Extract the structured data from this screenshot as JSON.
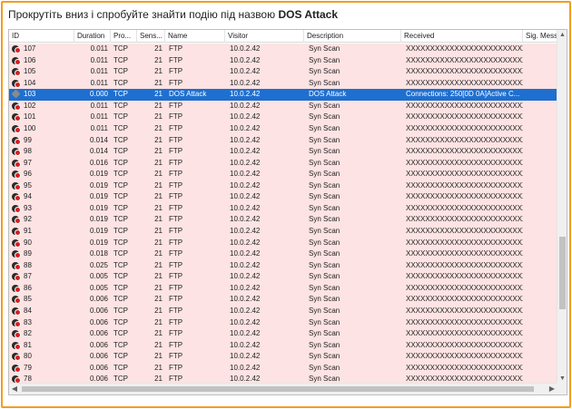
{
  "instruction": {
    "prefix": "Прокрутіть вниз і спробуйте знайти подію під назвою ",
    "target": "DOS Attack"
  },
  "columns": [
    "ID",
    "Duration",
    "Pro...",
    "Sens...",
    "Name",
    "Visitor",
    "Description",
    "Received",
    "Sig. Message"
  ],
  "colors": {
    "row_bg": "#fde3e3",
    "selected_bg": "#1e6fd0",
    "accent_border": "#f39c1f"
  },
  "icons": {
    "event": "bug-alert-icon",
    "selected_event": "bug-icon"
  },
  "rows": [
    {
      "id": "107",
      "duration": "0.011",
      "protocol": "TCP",
      "sensor": "21",
      "name": "FTP",
      "visitor": "10.0.2.42",
      "description": "Syn Scan",
      "received": "XXXXXXXXXXXXXXXXXXXXXXXXX...",
      "selected": false
    },
    {
      "id": "106",
      "duration": "0.011",
      "protocol": "TCP",
      "sensor": "21",
      "name": "FTP",
      "visitor": "10.0.2.42",
      "description": "Syn Scan",
      "received": "XXXXXXXXXXXXXXXXXXXXXXXXX...",
      "selected": false
    },
    {
      "id": "105",
      "duration": "0.011",
      "protocol": "TCP",
      "sensor": "21",
      "name": "FTP",
      "visitor": "10.0.2.42",
      "description": "Syn Scan",
      "received": "XXXXXXXXXXXXXXXXXXXXXXXXX...",
      "selected": false
    },
    {
      "id": "104",
      "duration": "0.011",
      "protocol": "TCP",
      "sensor": "21",
      "name": "FTP",
      "visitor": "10.0.2.42",
      "description": "Syn Scan",
      "received": "XXXXXXXXXXXXXXXXXXXXXXXXX...",
      "selected": false
    },
    {
      "id": "103",
      "duration": "0.000",
      "protocol": "TCP",
      "sensor": "21",
      "name": "DOS Attack",
      "visitor": "10.0.2.42",
      "description": "DOS Attack",
      "received": "Connections: 250[0D 0A]Active C...",
      "selected": true
    },
    {
      "id": "102",
      "duration": "0.011",
      "protocol": "TCP",
      "sensor": "21",
      "name": "FTP",
      "visitor": "10.0.2.42",
      "description": "Syn Scan",
      "received": "XXXXXXXXXXXXXXXXXXXXXXXXX...",
      "selected": false
    },
    {
      "id": "101",
      "duration": "0.011",
      "protocol": "TCP",
      "sensor": "21",
      "name": "FTP",
      "visitor": "10.0.2.42",
      "description": "Syn Scan",
      "received": "XXXXXXXXXXXXXXXXXXXXXXXXX...",
      "selected": false
    },
    {
      "id": "100",
      "duration": "0.011",
      "protocol": "TCP",
      "sensor": "21",
      "name": "FTP",
      "visitor": "10.0.2.42",
      "description": "Syn Scan",
      "received": "XXXXXXXXXXXXXXXXXXXXXXXXX...",
      "selected": false
    },
    {
      "id": "99",
      "duration": "0.014",
      "protocol": "TCP",
      "sensor": "21",
      "name": "FTP",
      "visitor": "10.0.2.42",
      "description": "Syn Scan",
      "received": "XXXXXXXXXXXXXXXXXXXXXXXXX...",
      "selected": false
    },
    {
      "id": "98",
      "duration": "0.014",
      "protocol": "TCP",
      "sensor": "21",
      "name": "FTP",
      "visitor": "10.0.2.42",
      "description": "Syn Scan",
      "received": "XXXXXXXXXXXXXXXXXXXXXXXXX...",
      "selected": false
    },
    {
      "id": "97",
      "duration": "0.016",
      "protocol": "TCP",
      "sensor": "21",
      "name": "FTP",
      "visitor": "10.0.2.42",
      "description": "Syn Scan",
      "received": "XXXXXXXXXXXXXXXXXXXXXXXXX...",
      "selected": false
    },
    {
      "id": "96",
      "duration": "0.019",
      "protocol": "TCP",
      "sensor": "21",
      "name": "FTP",
      "visitor": "10.0.2.42",
      "description": "Syn Scan",
      "received": "XXXXXXXXXXXXXXXXXXXXXXXXX...",
      "selected": false
    },
    {
      "id": "95",
      "duration": "0.019",
      "protocol": "TCP",
      "sensor": "21",
      "name": "FTP",
      "visitor": "10.0.2.42",
      "description": "Syn Scan",
      "received": "XXXXXXXXXXXXXXXXXXXXXXXXX...",
      "selected": false
    },
    {
      "id": "94",
      "duration": "0.019",
      "protocol": "TCP",
      "sensor": "21",
      "name": "FTP",
      "visitor": "10.0.2.42",
      "description": "Syn Scan",
      "received": "XXXXXXXXXXXXXXXXXXXXXXXXX...",
      "selected": false
    },
    {
      "id": "93",
      "duration": "0.019",
      "protocol": "TCP",
      "sensor": "21",
      "name": "FTP",
      "visitor": "10.0.2.42",
      "description": "Syn Scan",
      "received": "XXXXXXXXXXXXXXXXXXXXXXXXX...",
      "selected": false
    },
    {
      "id": "92",
      "duration": "0.019",
      "protocol": "TCP",
      "sensor": "21",
      "name": "FTP",
      "visitor": "10.0.2.42",
      "description": "Syn Scan",
      "received": "XXXXXXXXXXXXXXXXXXXXXXXXX...",
      "selected": false
    },
    {
      "id": "91",
      "duration": "0.019",
      "protocol": "TCP",
      "sensor": "21",
      "name": "FTP",
      "visitor": "10.0.2.42",
      "description": "Syn Scan",
      "received": "XXXXXXXXXXXXXXXXXXXXXXXXX...",
      "selected": false
    },
    {
      "id": "90",
      "duration": "0.019",
      "protocol": "TCP",
      "sensor": "21",
      "name": "FTP",
      "visitor": "10.0.2.42",
      "description": "Syn Scan",
      "received": "XXXXXXXXXXXXXXXXXXXXXXXXX...",
      "selected": false
    },
    {
      "id": "89",
      "duration": "0.018",
      "protocol": "TCP",
      "sensor": "21",
      "name": "FTP",
      "visitor": "10.0.2.42",
      "description": "Syn Scan",
      "received": "XXXXXXXXXXXXXXXXXXXXXXXXX...",
      "selected": false
    },
    {
      "id": "88",
      "duration": "0.025",
      "protocol": "TCP",
      "sensor": "21",
      "name": "FTP",
      "visitor": "10.0.2.42",
      "description": "Syn Scan",
      "received": "XXXXXXXXXXXXXXXXXXXXXXXXX...",
      "selected": false
    },
    {
      "id": "87",
      "duration": "0.005",
      "protocol": "TCP",
      "sensor": "21",
      "name": "FTP",
      "visitor": "10.0.2.42",
      "description": "Syn Scan",
      "received": "XXXXXXXXXXXXXXXXXXXXXXXXX...",
      "selected": false
    },
    {
      "id": "86",
      "duration": "0.005",
      "protocol": "TCP",
      "sensor": "21",
      "name": "FTP",
      "visitor": "10.0.2.42",
      "description": "Syn Scan",
      "received": "XXXXXXXXXXXXXXXXXXXXXXXXX...",
      "selected": false
    },
    {
      "id": "85",
      "duration": "0.006",
      "protocol": "TCP",
      "sensor": "21",
      "name": "FTP",
      "visitor": "10.0.2.42",
      "description": "Syn Scan",
      "received": "XXXXXXXXXXXXXXXXXXXXXXXXX...",
      "selected": false
    },
    {
      "id": "84",
      "duration": "0.006",
      "protocol": "TCP",
      "sensor": "21",
      "name": "FTP",
      "visitor": "10.0.2.42",
      "description": "Syn Scan",
      "received": "XXXXXXXXXXXXXXXXXXXXXXXXX...",
      "selected": false
    },
    {
      "id": "83",
      "duration": "0.006",
      "protocol": "TCP",
      "sensor": "21",
      "name": "FTP",
      "visitor": "10.0.2.42",
      "description": "Syn Scan",
      "received": "XXXXXXXXXXXXXXXXXXXXXXXXX...",
      "selected": false
    },
    {
      "id": "82",
      "duration": "0.006",
      "protocol": "TCP",
      "sensor": "21",
      "name": "FTP",
      "visitor": "10.0.2.42",
      "description": "Syn Scan",
      "received": "XXXXXXXXXXXXXXXXXXXXXXXXX...",
      "selected": false
    },
    {
      "id": "81",
      "duration": "0.006",
      "protocol": "TCP",
      "sensor": "21",
      "name": "FTP",
      "visitor": "10.0.2.42",
      "description": "Syn Scan",
      "received": "XXXXXXXXXXXXXXXXXXXXXXXXX...",
      "selected": false
    },
    {
      "id": "80",
      "duration": "0.006",
      "protocol": "TCP",
      "sensor": "21",
      "name": "FTP",
      "visitor": "10.0.2.42",
      "description": "Syn Scan",
      "received": "XXXXXXXXXXXXXXXXXXXXXXXXX...",
      "selected": false
    },
    {
      "id": "79",
      "duration": "0.006",
      "protocol": "TCP",
      "sensor": "21",
      "name": "FTP",
      "visitor": "10.0.2.42",
      "description": "Syn Scan",
      "received": "XXXXXXXXXXXXXXXXXXXXXXXXX...",
      "selected": false
    },
    {
      "id": "78",
      "duration": "0.006",
      "protocol": "TCP",
      "sensor": "21",
      "name": "FTP",
      "visitor": "10.0.2.42",
      "description": "Syn Scan",
      "received": "XXXXXXXXXXXXXXXXXXXXXXXXX...",
      "selected": false
    }
  ]
}
